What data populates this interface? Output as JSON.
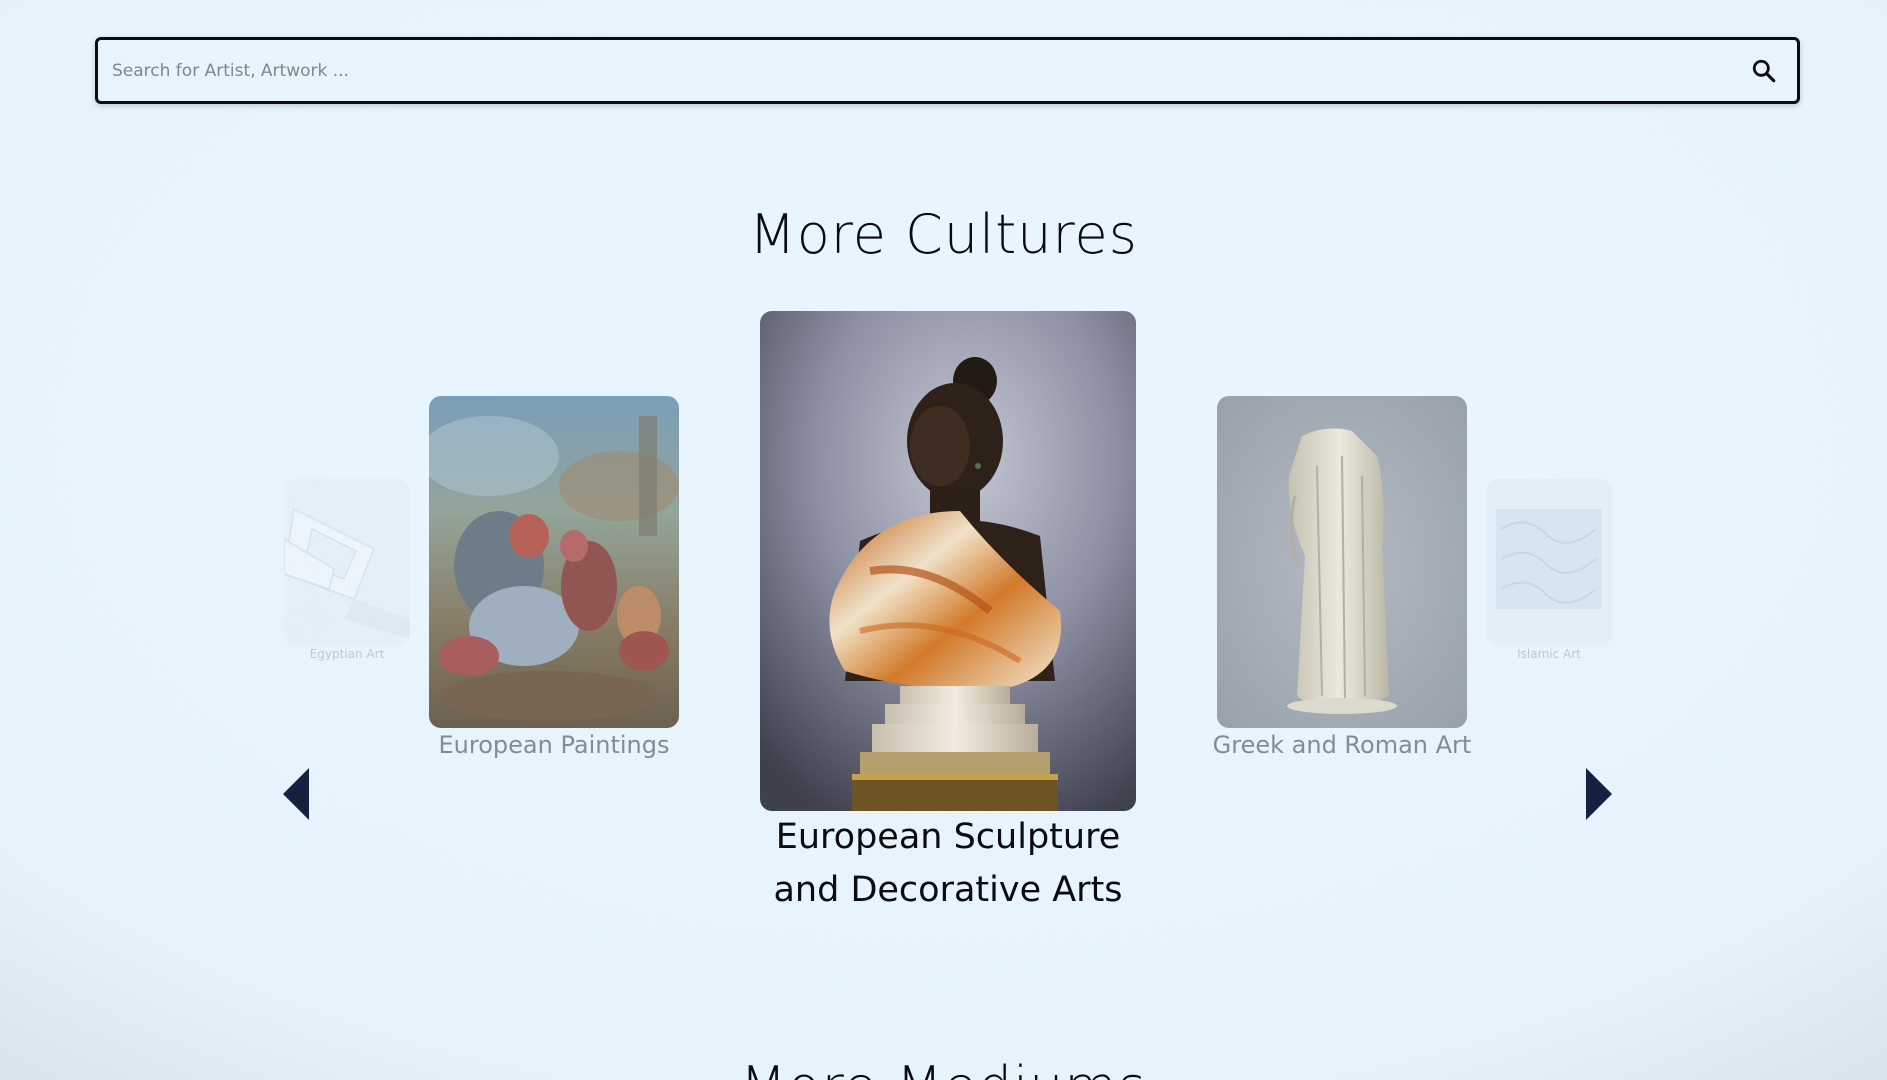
{
  "search": {
    "placeholder": "Search for Artist, Artwork ...",
    "icon": "search-icon"
  },
  "sections": {
    "cultures_title": "More Cultures",
    "mediums_title": "More Mediums"
  },
  "carousel": {
    "items": [
      {
        "label": "Egyptian Art",
        "position": "far-left"
      },
      {
        "label": "European Paintings",
        "position": "left"
      },
      {
        "label": "European Sculpture and Decorative Arts",
        "position": "center"
      },
      {
        "label": "Greek and Roman Art",
        "position": "right"
      },
      {
        "label": "Islamic Art",
        "position": "far-right"
      }
    ],
    "prev_icon": "caret-left-icon",
    "next_icon": "caret-right-icon"
  },
  "colors": {
    "background": "#e7f4fe",
    "arrow": "#14223f",
    "text": "#0b0b10"
  }
}
